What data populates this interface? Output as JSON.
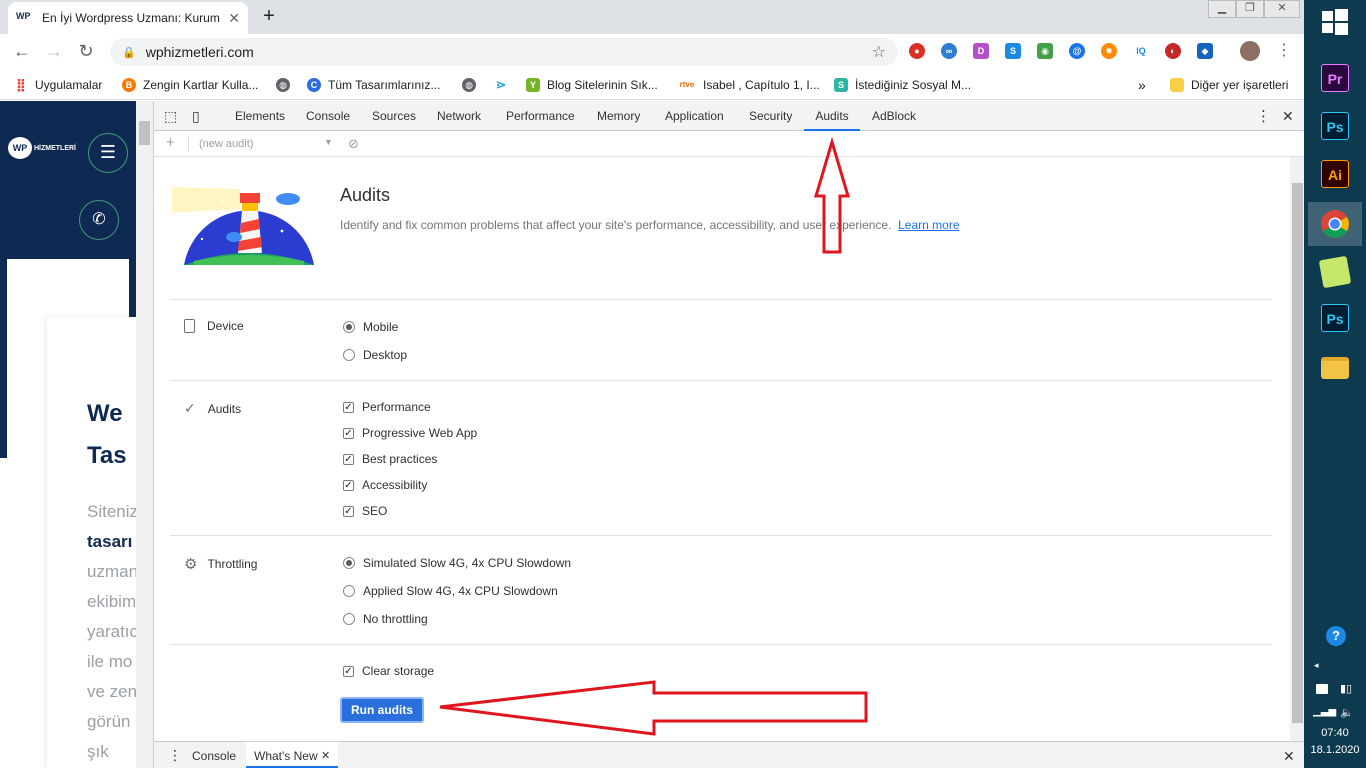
{
  "browser": {
    "tab_title": "En İyi Wordpress Uzmanı: Kurum",
    "tab_favicon": "WP",
    "new_tab": "+",
    "url": "wphizmetleri.com",
    "min": "▁",
    "restore": "❐",
    "close": "✕"
  },
  "bookmarks": [
    {
      "label": "Uygulamalar",
      "icon": "apps-icon",
      "color": "#ea4335"
    },
    {
      "label": "Zengin Kartlar Kulla...",
      "icon": "blogger-icon",
      "color": "#f57c00"
    },
    {
      "label": "",
      "icon": "globe-icon",
      "color": "#5f6368"
    },
    {
      "label": "Tüm Tasarımlarınız...",
      "icon": "canva-icon",
      "color": "#2d6cdf"
    },
    {
      "label": "",
      "icon": "globe-icon",
      "color": "#5f6368"
    },
    {
      "label": "",
      "icon": "sparkle-icon",
      "color": "#2d9cdb"
    },
    {
      "label": "Blog Sitelerinin Sık...",
      "icon": "yoast-icon",
      "color": "#77b227"
    },
    {
      "label": "Isabel , Capítulo 1, I...",
      "icon": "rtve-icon",
      "color": "#e66a00"
    },
    {
      "label": "İstediğiniz Sosyal M...",
      "icon": "s-icon",
      "color": "#2bb5a4"
    }
  ],
  "bookmarks_more": "»",
  "bookmarks_other": "Diğer yer işaretleri",
  "page": {
    "logo_text": "HİZMETLERİ",
    "logo_mark": "WP",
    "hero_heading": "We Tas",
    "hero_lines": [
      "Siteniz",
      "tasarı",
      "uzman",
      "ekibim",
      "yaratıc",
      "ile mo",
      "ve zen",
      "görün",
      "şık"
    ]
  },
  "devtools": {
    "tabs": [
      "Elements",
      "Console",
      "Sources",
      "Network",
      "Performance",
      "Memory",
      "Application",
      "Security",
      "Audits",
      "AdBlock"
    ],
    "active_tab": "Audits",
    "sub_placeholder": "(new audit)",
    "sub_plus": "+",
    "audits_title": "Audits",
    "audits_desc": "Identify and fix common problems that affect your site's performance, accessibility, and user experience.",
    "learn_more": "Learn more",
    "device_label": "Device",
    "device_options": [
      {
        "label": "Mobile",
        "checked": true
      },
      {
        "label": "Desktop",
        "checked": false
      }
    ],
    "audits_label": "Audits",
    "audit_categories": [
      {
        "label": "Performance",
        "checked": true
      },
      {
        "label": "Progressive Web App",
        "checked": true
      },
      {
        "label": "Best practices",
        "checked": true
      },
      {
        "label": "Accessibility",
        "checked": true
      },
      {
        "label": "SEO",
        "checked": true
      }
    ],
    "throttling_label": "Throttling",
    "throttling_options": [
      {
        "label": "Simulated Slow 4G, 4x CPU Slowdown",
        "checked": true
      },
      {
        "label": "Applied Slow 4G, 4x CPU Slowdown",
        "checked": false
      },
      {
        "label": "No throttling",
        "checked": false
      }
    ],
    "clear_storage": "Clear storage",
    "run_button": "Run audits",
    "drawer_tabs": [
      "Console",
      "What's New"
    ],
    "drawer_close_tab": "✕"
  },
  "taskbar": {
    "apps": [
      {
        "name": "windows-start",
        "text": "",
        "bg": "#0d3a4e",
        "fg": "#fff"
      },
      {
        "name": "premiere-icon",
        "text": "Pr",
        "bg": "#2a0a3e",
        "fg": "#e77cff"
      },
      {
        "name": "photoshop-icon",
        "text": "Ps",
        "bg": "#001d34",
        "fg": "#31c5f4"
      },
      {
        "name": "illustrator-icon",
        "text": "Ai",
        "bg": "#330000",
        "fg": "#ff9a00"
      },
      {
        "name": "chrome-icon",
        "text": "",
        "bg": "#dbe4ea",
        "fg": "#fff"
      },
      {
        "name": "sticky-notes-icon",
        "text": "",
        "bg": "transparent",
        "fg": "#fff"
      },
      {
        "name": "photoshop-icon-2",
        "text": "Ps",
        "bg": "#001d34",
        "fg": "#31c5f4"
      },
      {
        "name": "file-explorer-icon",
        "text": "",
        "bg": "transparent",
        "fg": "#fff"
      }
    ],
    "time": "07:40",
    "date": "18.1.2020"
  },
  "colors": {
    "accent": "#1a73e8",
    "navy": "#0f2a52",
    "annotation": "#e0151e"
  }
}
